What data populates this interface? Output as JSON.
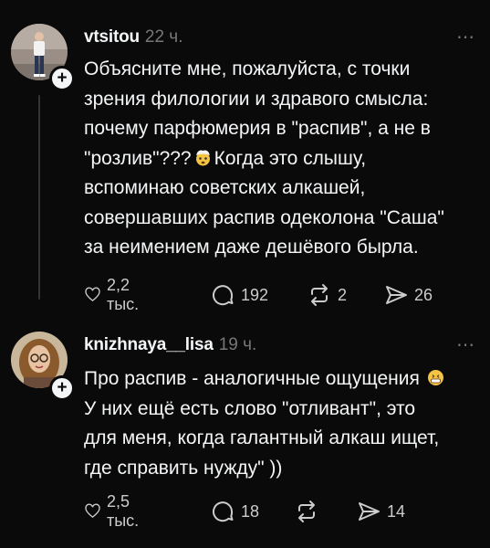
{
  "posts": [
    {
      "username": "vtsitou",
      "time": "22 ч.",
      "lines": [
        "Объясните мне, пожалуйста, с точки",
        "зрения филологии и здравого смысла:",
        "почему  парфюмерия в \"распив\", а не в",
        "\"розлив\"???",
        "Когда это слышу,",
        "вспоминаю советских алкашей,",
        "совершавших распив одеколона \"Саша\"",
        "за неимением даже дешёвого бырла."
      ],
      "emoji": "exploding-head-emoji",
      "likes": "2,2 тыс.",
      "replies": "192",
      "reposts": "2",
      "shares": "26"
    },
    {
      "username": "knizhnaya__lisa",
      "time": "19 ч.",
      "lines": [
        "Про распив - аналогичные ощущения",
        "У них ещё есть слово \"отливант\", это",
        "для меня, когда галантный алкаш ищет,",
        "где справить нужду\" ))"
      ],
      "emoji": "grinning-face-emoji",
      "likes": "2,5 тыс.",
      "replies": "18",
      "reposts": "",
      "shares": "14"
    }
  ],
  "more_icon": "⋯",
  "follow_icon": "+",
  "colors": {
    "background": "#0a0a0a",
    "text": "#f3f5f7",
    "muted": "#777777",
    "thread_line": "#333638"
  }
}
